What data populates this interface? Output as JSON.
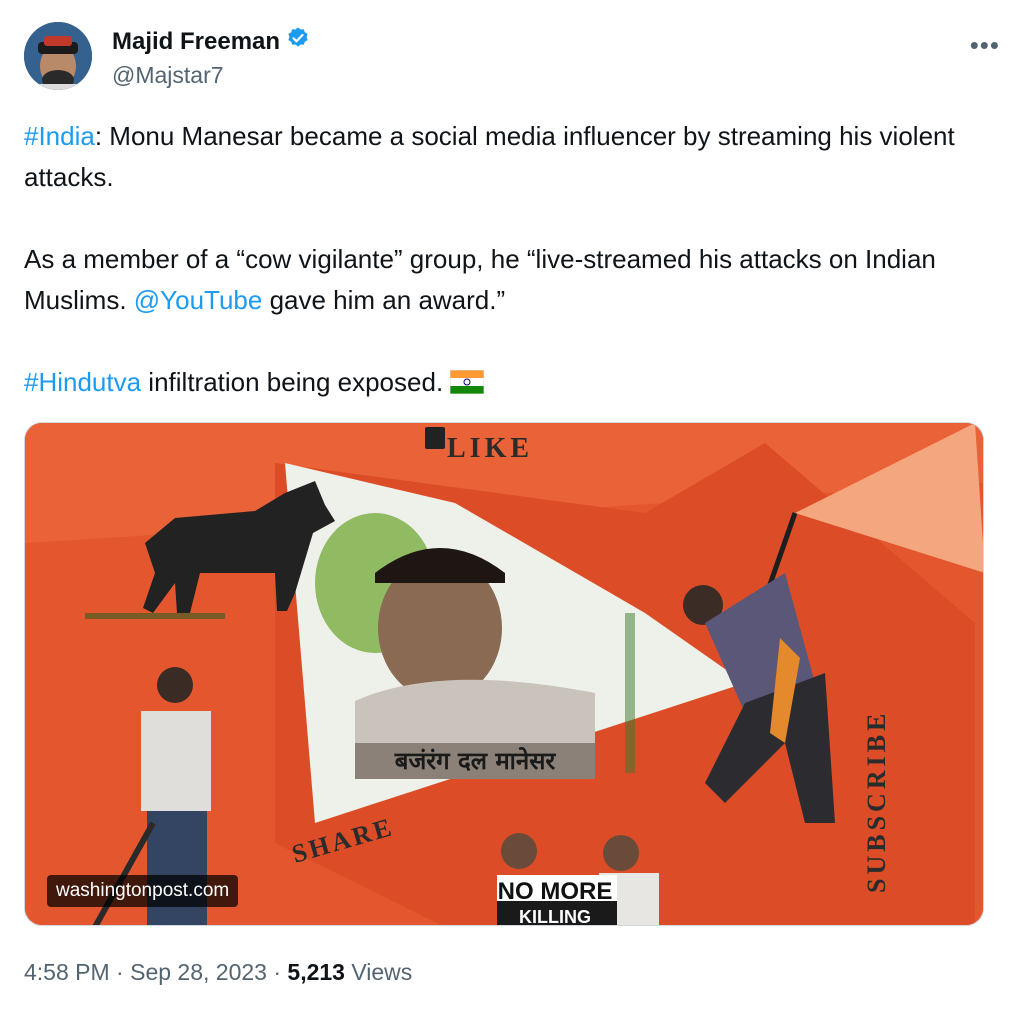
{
  "author": {
    "display_name": "Majid Freeman",
    "handle": "@Majstar7",
    "verified": true
  },
  "menu_icon": "more-horizontal-icon",
  "tweet": {
    "line1_link": "#India",
    "line1_text": ": Monu Manesar became a social media influencer by streaming his violent attacks.",
    "line2_text_a": "As a member of a “cow vigilante” group, he “live-streamed his attacks on Indian Muslims. ",
    "line2_link": "@YouTube",
    "line2_text_b": " gave him an award.”",
    "line3_link": "#Hindutva",
    "line3_text": " infiltration being exposed. ",
    "flag_emoji": "🇮🇳"
  },
  "media": {
    "source": "washingtonpost.com",
    "collage_texts": {
      "like": "LIKE",
      "share": "SHARE",
      "subscribe": "SUBSCRIBE",
      "hindi_caption": "बजंरंग दल मानेसर",
      "protest_sign": "NO MORE KILLING"
    },
    "colors": {
      "background": "#e4572e",
      "flag": "#f4a77e"
    }
  },
  "meta": {
    "time": "4:58 PM",
    "date": "Sep 28, 2023",
    "separator": "·",
    "views_count": "5,213",
    "views_label": "Views"
  },
  "colors": {
    "link": "#1d9bf0",
    "secondary": "#536471",
    "verified": "#1d9bf0"
  }
}
